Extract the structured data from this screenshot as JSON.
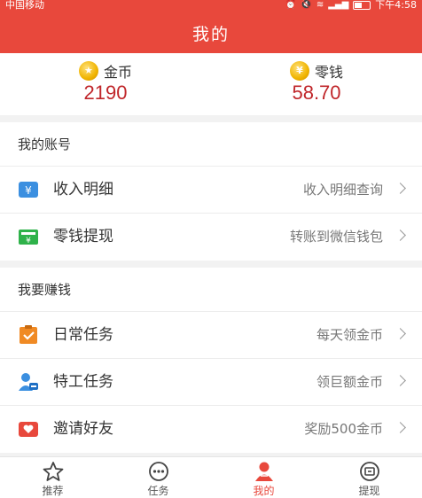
{
  "status_bar": {
    "carrier": "中国移动",
    "time": "下午4:58"
  },
  "header": {
    "title": "我的"
  },
  "balance": {
    "coins": {
      "label": "金币",
      "value": "2190"
    },
    "change": {
      "label": "零钱",
      "value": "58.70"
    }
  },
  "account": {
    "title": "我的账号",
    "items": [
      {
        "label": "收入明细",
        "hint": "收入明细查询",
        "icon": "yuan-card-icon"
      },
      {
        "label": "零钱提现",
        "hint": "转账到微信钱包",
        "icon": "wallet-icon"
      }
    ]
  },
  "earn": {
    "title": "我要赚钱",
    "items": [
      {
        "label": "日常任务",
        "hint": "每天领金币",
        "icon": "clipboard-check-icon"
      },
      {
        "label": "特工任务",
        "hint": "领巨额金币",
        "icon": "agent-icon"
      },
      {
        "label": "邀请好友",
        "hint": "奖励500金币",
        "icon": "heart-envelope-icon"
      }
    ]
  },
  "tabs": [
    {
      "label": "推荐",
      "icon": "star-icon"
    },
    {
      "label": "任务",
      "icon": "chat-dots-icon"
    },
    {
      "label": "我的",
      "icon": "user-icon"
    },
    {
      "label": "提现",
      "icon": "withdraw-icon"
    }
  ],
  "colors": {
    "brand": "#e8483c",
    "value": "#c0262a",
    "coin": "#f0b400"
  }
}
